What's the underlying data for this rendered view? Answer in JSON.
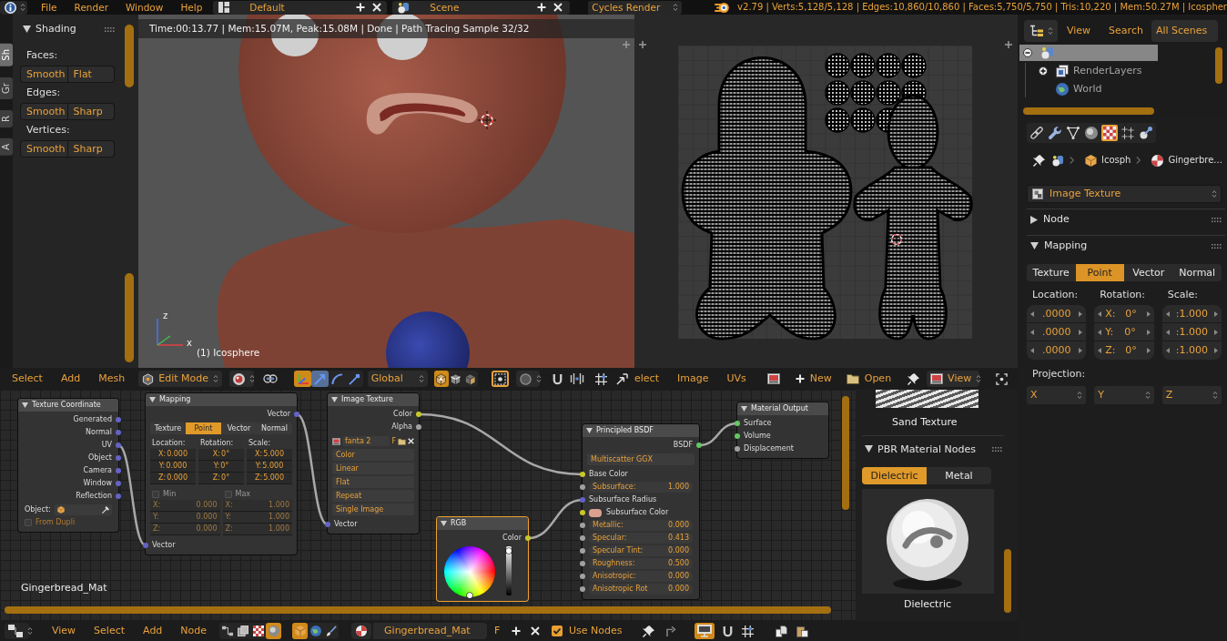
{
  "top_bar": {
    "menus": [
      "File",
      "Render",
      "Window",
      "Help"
    ],
    "screen_layout": "Default",
    "scene": "Scene",
    "render_engine": "Cycles Render",
    "stats": "v2.79 | Verts:5,128/5,128 | Edges:10,860/10,860 | Faces:5,750/5,750 | Tris:10,220 | Mem:50.27M | Icospher"
  },
  "tool_shelf": {
    "tabs": [
      {
        "label": "Sh",
        "selected": true
      },
      {
        "label": "Gr",
        "selected": false
      },
      {
        "label": "R",
        "selected": false
      },
      {
        "label": "A",
        "selected": false
      }
    ],
    "panel": {
      "title": "Shading",
      "expanded": true,
      "groups": [
        {
          "label": "Faces:",
          "options": [
            "Smooth",
            "Flat"
          ]
        },
        {
          "label": "Edges:",
          "options": [
            "Smooth",
            "Sharp"
          ]
        },
        {
          "label": "Vertices:",
          "options": [
            "Smooth",
            "Sharp"
          ]
        }
      ]
    }
  },
  "viewport": {
    "render_info": "Time:00:13.77 | Mem:15.07M, Peak:15.08M | Done | Path Tracing Sample 32/32",
    "axis_labels": [
      "z",
      "x"
    ],
    "object_label": "(1) Icosphere"
  },
  "viewport_header": {
    "menus": [
      "Select",
      "Add",
      "Mesh"
    ],
    "mode": "Edit Mode",
    "manipulator": {
      "on": true
    },
    "transform_modes": [
      {
        "selected": true
      },
      {
        "selected": false
      },
      {
        "selected": false
      }
    ],
    "orientation": "Global",
    "select_modes": [
      {
        "selected": true
      },
      {
        "selected": false
      },
      {
        "selected": false
      }
    ],
    "occlude_geometry": {
      "on": true
    }
  },
  "image_editor_header": {
    "menus": [
      "elect",
      "Image",
      "UVs"
    ],
    "new_label": "New",
    "open_label": "Open",
    "view_label": "View"
  },
  "node_editor": {
    "material_label": "Gingerbread_Mat",
    "nodes": {
      "texture_coordinate": {
        "title": "Texture Coordinate",
        "selected": false,
        "outputs": [
          "Generated",
          "Normal",
          "UV",
          "Object",
          "Camera",
          "Window",
          "Reflection"
        ],
        "object_label": "Object:",
        "from_dupli": {
          "label": "From Dupli",
          "checked": false
        }
      },
      "mapping": {
        "title": "Mapping",
        "selected": false,
        "output": "Vector",
        "tabs": [
          {
            "label": "Texture",
            "selected": false
          },
          {
            "label": "Point",
            "selected": true
          },
          {
            "label": "Vector",
            "selected": false
          },
          {
            "label": "Normal",
            "selected": false
          }
        ],
        "columns": [
          {
            "label": "Location:",
            "fields": [
              {
                "axis": "X:",
                "value": "0.000"
              },
              {
                "axis": "Y:",
                "value": "0.000"
              },
              {
                "axis": "Z:",
                "value": "0.000"
              }
            ]
          },
          {
            "label": "Rotation:",
            "fields": [
              {
                "axis": "X:",
                "value": "0°"
              },
              {
                "axis": "Y:",
                "value": "0°"
              },
              {
                "axis": "Z:",
                "value": "0°"
              }
            ]
          },
          {
            "label": "Scale:",
            "fields": [
              {
                "axis": "X:",
                "value": "5.000"
              },
              {
                "axis": "Y:",
                "value": "5.000"
              },
              {
                "axis": "Z:",
                "value": "5.000"
              }
            ]
          }
        ],
        "limits": [
          {
            "label": "Min",
            "checked": false,
            "fields": [
              {
                "axis": "X:",
                "value": "0.000"
              },
              {
                "axis": "Y:",
                "value": "0.000"
              },
              {
                "axis": "Z:",
                "value": "0.000"
              }
            ]
          },
          {
            "label": "Max",
            "checked": false,
            "fields": [
              {
                "axis": "X:",
                "value": "1.000"
              },
              {
                "axis": "Y:",
                "value": "1.000"
              },
              {
                "axis": "Z:",
                "value": "1.000"
              }
            ]
          }
        ],
        "input": "Vector"
      },
      "image_texture": {
        "title": "Image Texture",
        "selected": false,
        "outputs": [
          {
            "label": "Color",
            "color": "#c7c729"
          },
          {
            "label": "Alpha",
            "color": "#a1a1a1"
          }
        ],
        "image": "fanta 2",
        "fake_user": "F",
        "options": [
          "Color",
          "Linear",
          "Flat",
          "Repeat",
          "Single Image"
        ],
        "input": "Vector"
      },
      "principled_bsdf": {
        "title": "Principled BSDF",
        "selected": false,
        "output": "BSDF",
        "distribution": "Multiscatter GGX",
        "inputs": [
          {
            "kind": "socket",
            "label": "Base Color",
            "color": "#c7c729"
          },
          {
            "kind": "value",
            "label": "Subsurface:",
            "value": "1.000",
            "color": "#a1a1a1"
          },
          {
            "kind": "socket",
            "label": "Subsurface Radius",
            "color": "#6363c7"
          },
          {
            "kind": "swatch",
            "label": "Subsurface Color",
            "color": "#c7c729",
            "swatch": {
              "color": "#d9a090"
            }
          },
          {
            "kind": "value",
            "label": "Metallic:",
            "value": "0.000",
            "color": "#a1a1a1"
          },
          {
            "kind": "value",
            "label": "Specular:",
            "value": "0.413",
            "color": "#a1a1a1"
          },
          {
            "kind": "value",
            "label": "Specular Tint:",
            "value": "0.000",
            "color": "#a1a1a1"
          },
          {
            "kind": "value",
            "label": "Roughness:",
            "value": "0.500",
            "color": "#a1a1a1"
          },
          {
            "kind": "value",
            "label": "Anisotropic:",
            "value": "0.000",
            "color": "#a1a1a1"
          },
          {
            "kind": "value",
            "label": "Anisotropic Rot",
            "value": "0.000",
            "color": "#a1a1a1"
          }
        ]
      },
      "rgb": {
        "title": "RGB",
        "selected": true,
        "output": "Color",
        "brightness": {
          "level": 0.95
        }
      },
      "material_output": {
        "title": "Material Output",
        "selected": false,
        "inputs": [
          {
            "label": "Surface",
            "color": "#63c763"
          },
          {
            "label": "Volume",
            "color": "#63c763"
          },
          {
            "label": "Displacement",
            "color": "#a1a1a1"
          }
        ]
      }
    }
  },
  "node_sidebar": {
    "texture_name": "Sand Texture",
    "panel": {
      "title": "PBR Material Nodes",
      "expanded": true,
      "tabs": [
        {
          "label": "Dielectric",
          "selected": true
        },
        {
          "label": "Metal",
          "selected": false
        }
      ],
      "preview_label": "Dielectric"
    }
  },
  "node_editor_header": {
    "menus": [
      "View",
      "Select",
      "Add",
      "Node"
    ],
    "tree_types": [
      {
        "selected": false
      },
      {
        "selected": false
      },
      {
        "selected": false
      },
      {
        "selected": true
      }
    ],
    "shader_types": [
      {
        "selected": true
      },
      {
        "selected": false
      },
      {
        "selected": false
      }
    ],
    "material": "Gingerbread_Mat",
    "fake_user": "F",
    "use_nodes": {
      "label": "Use Nodes",
      "checked": true
    },
    "backdrop": {
      "on": true
    }
  },
  "outliner": {
    "menus": [
      "View",
      "Search"
    ],
    "display_mode": "All Scenes",
    "tree": [
      {
        "kind": "group",
        "selected": true,
        "expanded": true,
        "children": [
          {
            "kind": "group",
            "label": "RenderLayers",
            "selected": false,
            "expanded": false
          },
          {
            "kind": "leaf",
            "label": "World",
            "selected": false
          }
        ]
      }
    ]
  },
  "properties": {
    "tabs": [
      {
        "selected": false
      },
      {
        "selected": false
      },
      {
        "selected": false
      },
      {
        "selected": false
      },
      {
        "selected": true
      },
      {
        "selected": false
      },
      {
        "selected": false
      }
    ],
    "breadcrumbs": [
      "Icosph",
      "Gingerbre..."
    ],
    "texture_slot": "Image Texture",
    "panels": [
      {
        "title": "Node",
        "expanded": false
      },
      {
        "title": "Mapping",
        "expanded": true
      }
    ],
    "mapping": {
      "tabs": [
        {
          "label": "Texture",
          "selected": false
        },
        {
          "label": "Point",
          "selected": true
        },
        {
          "label": "Vector",
          "selected": false
        },
        {
          "label": "Normal",
          "selected": false
        }
      ],
      "columns": [
        {
          "label": "Location:",
          "fields": [
            {
              "value": ".0000"
            },
            {
              "value": ".0000"
            },
            {
              "value": ".0000"
            }
          ]
        },
        {
          "label": "Rotation:",
          "fields": [
            {
              "axis": "X:",
              "value": "0°"
            },
            {
              "axis": "Y:",
              "value": "0°"
            },
            {
              "axis": "Z:",
              "value": "0°"
            }
          ]
        },
        {
          "label": "Scale:",
          "fields": [
            {
              "value": ":1.000"
            },
            {
              "value": ":1.000"
            },
            {
              "value": ":1.000"
            }
          ]
        }
      ],
      "projection_label": "Projection:",
      "projection": [
        "X",
        "Y",
        "Z"
      ]
    }
  }
}
